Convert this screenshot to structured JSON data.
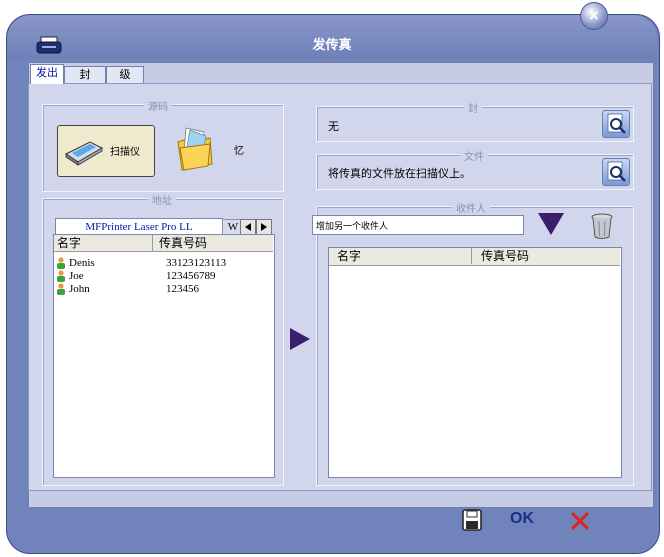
{
  "window": {
    "title": "发传真"
  },
  "tabs": [
    {
      "label": "发出",
      "active": true
    },
    {
      "label": "封",
      "active": false
    },
    {
      "label": "级",
      "active": false
    }
  ],
  "source": {
    "group_title": "源码",
    "scanner_label": "扫描仪",
    "memory_label": "忆"
  },
  "address": {
    "group_title": "地址",
    "book_tab": "MFPrinter Laser Pro LL",
    "book_tab2": "W",
    "columns": [
      "名字",
      "传真号码"
    ],
    "rows": [
      {
        "name": "Denis",
        "number": "33123123113"
      },
      {
        "name": "Joe",
        "number": "123456789"
      },
      {
        "name": "John",
        "number": "123456"
      }
    ]
  },
  "cover": {
    "group_title": "封",
    "value": "无"
  },
  "file": {
    "group_title": "文件",
    "value": "将传真的文件放在扫描仪上。"
  },
  "recipients": {
    "group_title": "收件人",
    "input_value": "增加另一个收件人",
    "columns": [
      "名字",
      "传真号码"
    ]
  },
  "footer": {
    "ok_label": "OK"
  },
  "colors": {
    "frame": "#7183bb",
    "arrow": "#3b1d6e",
    "delete": "#e0231a"
  }
}
